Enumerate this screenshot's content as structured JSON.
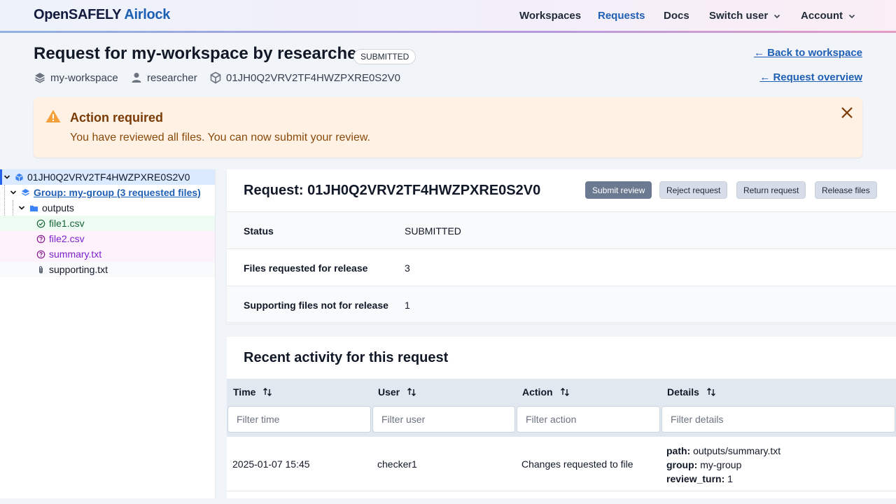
{
  "header": {
    "logo_part1": "OpenSAFELY",
    "logo_part2": "Airlock",
    "nav": {
      "workspaces": "Workspaces",
      "requests": "Requests",
      "docs": "Docs",
      "switch_user": "Switch user",
      "account": "Account"
    }
  },
  "page": {
    "title": "Request for my-workspace by researcher",
    "status_badge": "SUBMITTED",
    "meta": {
      "workspace": "my-workspace",
      "user": "researcher",
      "request_id": "01JH0Q2VRV2TF4HWZPXRE0S2V0"
    },
    "links": {
      "back_to_workspace": "← Back to workspace",
      "request_overview": "← Request overview"
    }
  },
  "alert": {
    "title": "Action required",
    "message": "You have reviewed all files. You can now submit your review."
  },
  "tree": {
    "root": "01JH0Q2VRV2TF4HWZPXRE0S2V0",
    "group": "Group: my-group (3 requested files)",
    "folder": "outputs",
    "files": [
      {
        "name": "file1.csv",
        "state": "approved"
      },
      {
        "name": "file2.csv",
        "state": "changes-requested"
      },
      {
        "name": "summary.txt",
        "state": "changes-requested"
      },
      {
        "name": "supporting.txt",
        "state": "supporting"
      }
    ]
  },
  "request_panel": {
    "title": "Request: 01JH0Q2VRV2TF4HWZPXRE0S2V0",
    "buttons": {
      "submit_review": "Submit review",
      "reject_request": "Reject request",
      "return_request": "Return request",
      "release_files": "Release files"
    },
    "summary": [
      {
        "key": "Status",
        "value": "SUBMITTED"
      },
      {
        "key": "Files requested for release",
        "value": "3"
      },
      {
        "key": "Supporting files not for release",
        "value": "1"
      }
    ]
  },
  "activity": {
    "title": "Recent activity for this request",
    "columns": {
      "time": "Time",
      "user": "User",
      "action": "Action",
      "details": "Details"
    },
    "filters": {
      "time": "Filter time",
      "user": "Filter user",
      "action": "Filter action",
      "details": "Filter details"
    },
    "rows": [
      {
        "time": "2025-01-07 15:45",
        "user": "checker1",
        "action": "Changes requested to file",
        "details": {
          "path_label": "path:",
          "path": "outputs/summary.txt",
          "group_label": "group:",
          "group": "my-group",
          "turn_label": "review_turn:",
          "turn": "1"
        }
      }
    ]
  }
}
